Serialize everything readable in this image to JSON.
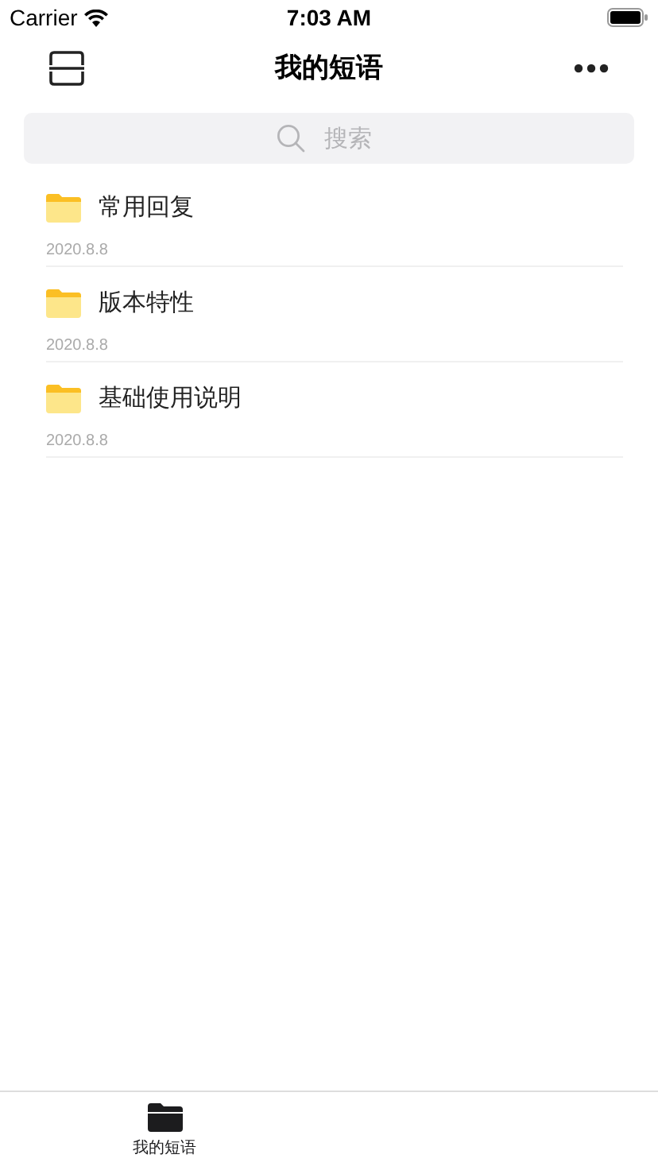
{
  "status_bar": {
    "carrier": "Carrier",
    "time": "7:03 AM"
  },
  "nav_bar": {
    "title": "我的短语"
  },
  "search": {
    "placeholder": "搜索"
  },
  "folders": [
    {
      "name": "常用回复",
      "date": "2020.8.8"
    },
    {
      "name": "版本特性",
      "date": "2020.8.8"
    },
    {
      "name": "基础使用说明",
      "date": "2020.8.8"
    }
  ],
  "tab_bar": {
    "tabs": [
      {
        "label": "我的短语",
        "selected": true
      }
    ]
  }
}
